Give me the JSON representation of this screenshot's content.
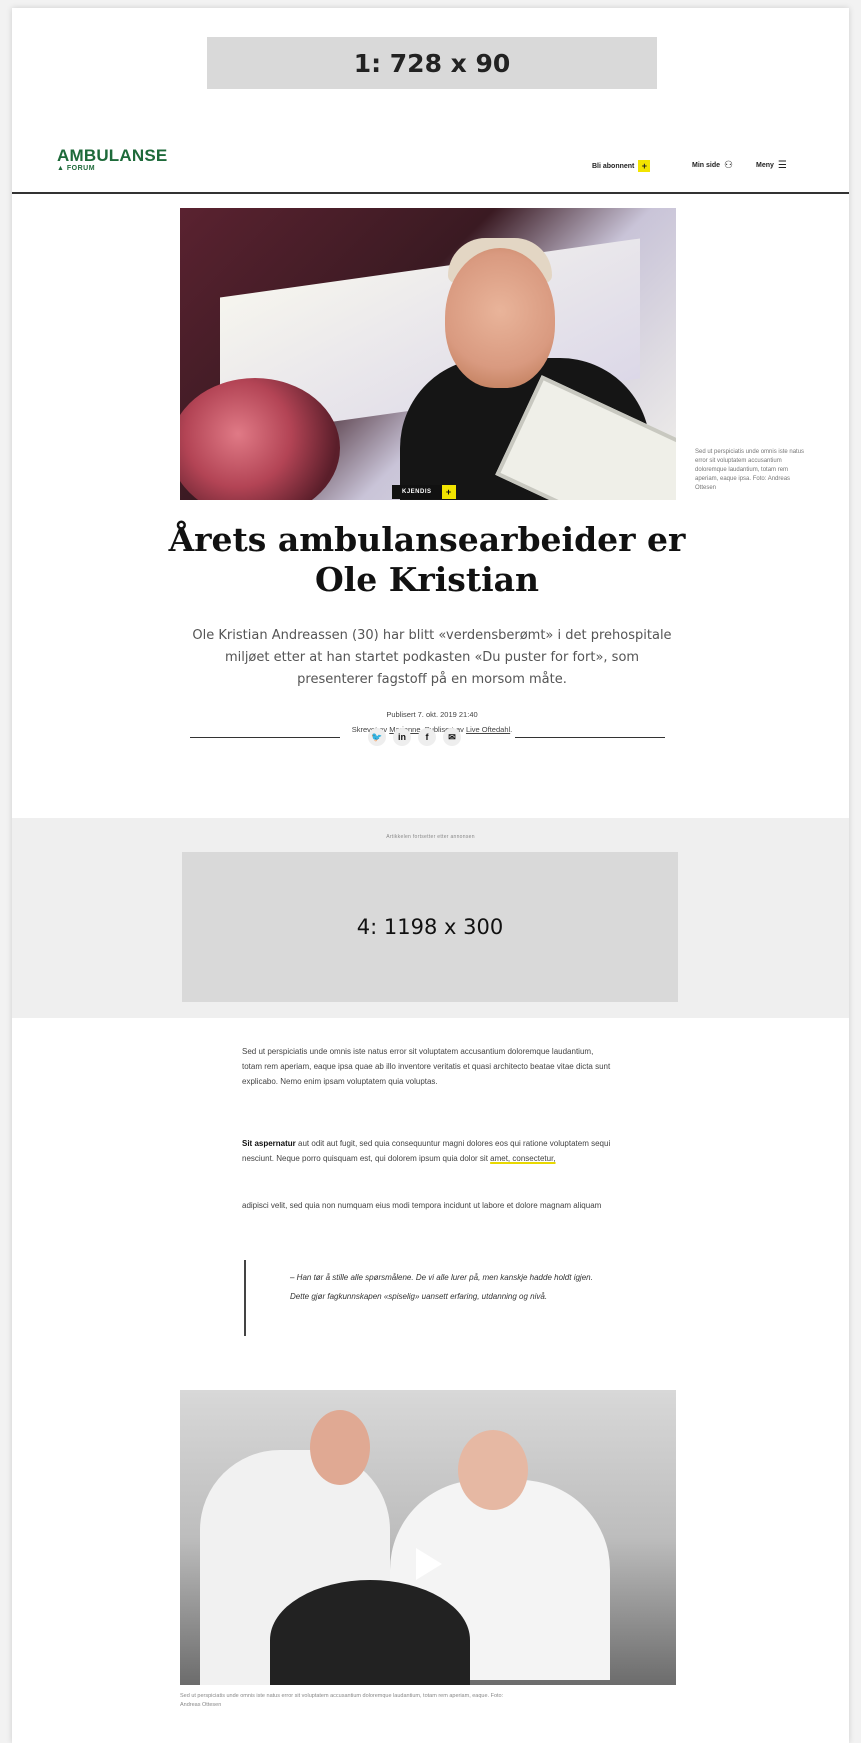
{
  "ads": {
    "top_label": "1: 728 x 90",
    "mid_label": "4: 1198 x 300",
    "mid_caption": "Artikkelen fortsetter etter annonsen"
  },
  "header": {
    "logo_main": "AMBULANSE",
    "logo_sub": "FORUM",
    "subscribe_label": "Bli abonnent",
    "subscribe_plus": "+",
    "min_side_label": "Min side",
    "meny_label": "Meny"
  },
  "hero": {
    "tag_label": "KJENDIS",
    "tag_plus": "+",
    "side_caption": "Sed ut perspiciatis unde omnis iste natus error sit voluptatem accusantium doloremque laudantium, totam rem aperiam, eaque ipsa. Foto: Andreas Ottesen"
  },
  "article": {
    "title": "Årets ambulansearbeider er Ole Kristian",
    "lead": "Ole Kristian Andreassen (30) har blitt «verdensberømt» i det prehospitale miljøet etter at han startet podkasten «Du puster for fort», som presenterer fagstoff på en morsom måte.",
    "published": "Publisert 7. okt. 2019 21:40",
    "byline_prefix": "Skrevet av ",
    "author": "Marianne",
    "byline_mid": ". Publisert av ",
    "publisher": "Live Oftedahl",
    "byline_end": "."
  },
  "share": {
    "twitter": "🐦",
    "linkedin": "in",
    "facebook": "f",
    "email": "✉"
  },
  "body": {
    "p1": "Sed ut perspiciatis unde omnis iste natus error sit voluptatem accusantium doloremque laudantium, totam rem aperiam, eaque ipsa quae ab illo inventore veritatis et quasi architecto beatae vitae dicta sunt explicabo. Nemo enim ipsam voluptatem quia voluptas.",
    "p2_bold": "Sit aspernatur",
    "p2_text": " aut odit aut fugit, sed quia consequuntur magni dolores eos qui ratione voluptatem sequi nesciunt. Neque porro quisquam est, qui dolorem ipsum quia dolor sit ",
    "p2_link": "amet, consectetur,",
    "p3": " adipisci velit, sed quia non numquam eius modi tempora incidunt ut labore et dolore magnam aliquam",
    "quote": "– Han tør å stille alle spørsmålene. De vi alle lurer på, men kanskje hadde holdt igjen. Dette gjør fagkunnskapen «spiselig» uansett erfaring, utdanning og nivå."
  },
  "video": {
    "caption": "Sed ut perspiciatis unde omnis iste natus error sit voluptatem accusantium doloremque laudantium, totam rem aperiam, eaque. Foto: Andreas Ottesen"
  }
}
